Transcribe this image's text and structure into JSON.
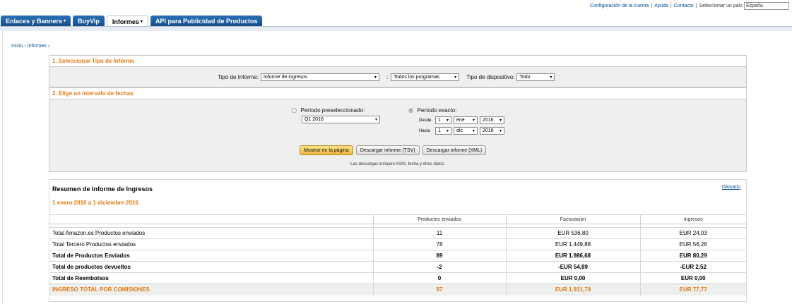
{
  "toplinks": {
    "account": "Configuración de la cuenta",
    "help": "Ayuda",
    "contact": "Contacto",
    "country_label": "Seleccionar un país",
    "country_value": "España"
  },
  "tabs": [
    {
      "label": "Enlaces y Banners",
      "caret": "▾"
    },
    {
      "label": "BuyVip",
      "caret": ""
    },
    {
      "label": "Informes",
      "caret": "▾"
    },
    {
      "label": "API para Publicidad de Productos",
      "caret": ""
    }
  ],
  "breadcrumb": "Inicio › Informes ›",
  "section1": {
    "title": "1. Seleccionar Tipo de Informe",
    "report_type_label": "Tipo de Informe:",
    "report_type_value": "Informe de ingresos",
    "separator": ":",
    "programs_value": "Todos los programas",
    "device_label": "Tipo de dispositivo:",
    "device_value": "Todo"
  },
  "section2": {
    "title": "2. Elige un intervalo de fechas",
    "preset_label": "Período preseleccionado:",
    "preset_value": "Q1 2016",
    "exact_label": "Período exacto:",
    "from_label": "Desde",
    "to_label": "Hasta",
    "from": {
      "day": "1",
      "month": "ene",
      "year": "2016"
    },
    "to": {
      "day": "1",
      "month": "dic",
      "year": "2016"
    },
    "btn_show": "Mostrar en la página",
    "btn_tsv": "Descargar informe (TSV)",
    "btn_xml": "Descargar informe (XML)",
    "note": "Las descargas incluyen ASIN, fecha y otros datos."
  },
  "summary": {
    "title": "Resumen de Informe de Ingresos",
    "glossary": "Glosario",
    "range": "1 enero 2016 a 1 diciembre 2016",
    "columns": [
      "Productos enviados",
      "Facturación",
      "Ingresos"
    ],
    "rows": [
      {
        "name": "Total Amazon.es Productos enviados",
        "shipped": "11",
        "billing": "EUR 536,80",
        "income": "EUR 24,03"
      },
      {
        "name": "Total Tercero Productos enviados",
        "shipped": "78",
        "billing": "EUR 1.449,88",
        "income": "EUR 56,26"
      },
      {
        "name": "Total de Productos Enviados",
        "shipped": "89",
        "billing": "EUR 1.986,68",
        "income": "EUR 80,29"
      },
      {
        "name": "Total de productos devueltos",
        "shipped": "-2",
        "billing": "-EUR 54,89",
        "income": "-EUR 2,52"
      },
      {
        "name": "Total de Reembolsos",
        "shipped": "0",
        "billing": "EUR 0,00",
        "income": "EUR 0,00"
      },
      {
        "name": "INGRESO TOTAL POR COMISIONES",
        "shipped": "87",
        "billing": "EUR 1.931,79",
        "income": "EUR 77,77"
      }
    ]
  },
  "colors": {
    "accent": "#e47911",
    "tab": "#1f5c9e",
    "link": "#004b91"
  },
  "icons": {
    "dropdown": "▾"
  }
}
